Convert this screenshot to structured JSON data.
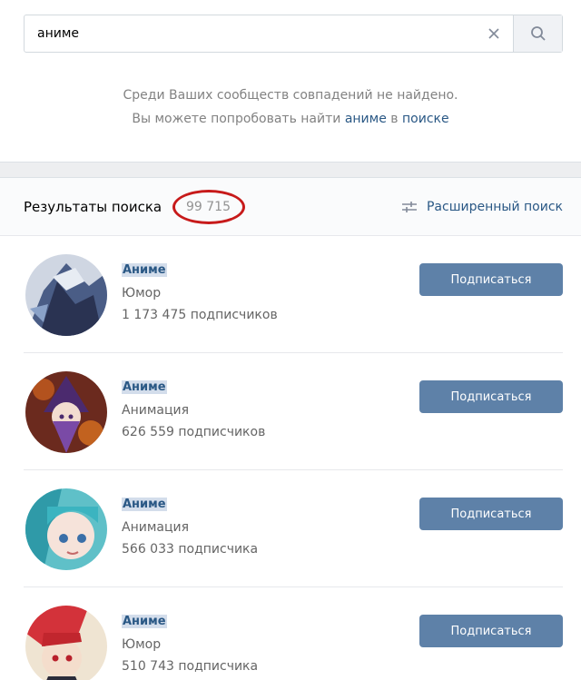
{
  "search": {
    "value": "аниме",
    "clear_icon": "close-icon",
    "search_icon": "search-icon"
  },
  "no_results": {
    "line1": "Среди Ваших сообществ совпадений не найдено.",
    "line2_prefix": "Вы можете попробовать найти",
    "line2_query": "аниме",
    "line2_middle": "в",
    "line2_link": "поиске"
  },
  "results": {
    "title": "Результаты поиска",
    "count": "99 715",
    "advanced_label": "Расширенный поиск",
    "advanced_icon": "sliders-icon"
  },
  "groups": [
    {
      "name": "Аниме",
      "category": "Юмор",
      "subscribers": "1 173 475 подписчиков",
      "button": "Подписаться"
    },
    {
      "name": "Аниме",
      "category": "Анимация",
      "subscribers": "626 559 подписчиков",
      "button": "Подписаться"
    },
    {
      "name": "Аниме",
      "category": "Анимация",
      "subscribers": "566 033 подписчика",
      "button": "Подписаться"
    },
    {
      "name": "Аниме",
      "category": "Юмор",
      "subscribers": "510 743 подписчика",
      "button": "Подписаться"
    }
  ],
  "colors": {
    "accent": "#5e81a8",
    "link": "#2a5885",
    "highlight_oval": "#c71a1a"
  }
}
